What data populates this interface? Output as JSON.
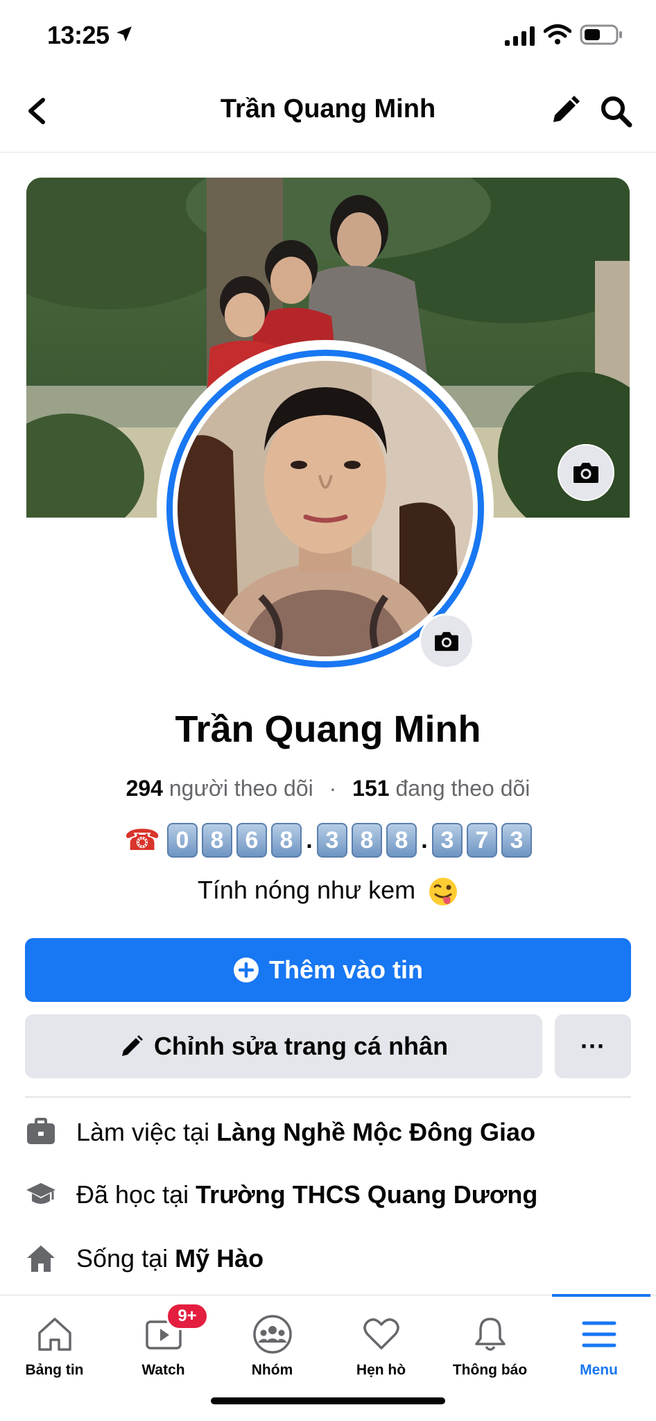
{
  "status_bar": {
    "time": "13:25"
  },
  "header": {
    "title": "Trần Quang Minh"
  },
  "profile": {
    "name": "Trần Quang Minh",
    "followers_count": "294",
    "followers_label": "người theo dõi",
    "following_count": "151",
    "following_label": "đang theo dõi",
    "separator": "·",
    "phone_digits": [
      "0",
      "8",
      "6",
      "8",
      ".",
      "3",
      "8",
      "8",
      ".",
      "3",
      "7",
      "3"
    ],
    "bio": "Tính nóng như kem"
  },
  "buttons": {
    "add_story": "Thêm vào tin",
    "edit_profile": "Chỉnh sửa trang cá nhân",
    "more": "···"
  },
  "details": [
    {
      "icon": "briefcase-icon",
      "prefix": "Làm việc tại",
      "value": "Làng Nghề Mộc Đông Giao"
    },
    {
      "icon": "graduation-cap-icon",
      "prefix": "Đã học tại",
      "value": "Trường THCS Quang Dương"
    },
    {
      "icon": "home-icon",
      "prefix": "Sống tại",
      "value": "Mỹ Hào"
    }
  ],
  "bottom_nav": {
    "items": [
      {
        "label": "Bảng tin",
        "icon": "home-icon"
      },
      {
        "label": "Watch",
        "icon": "video-icon",
        "badge": "9+"
      },
      {
        "label": "Nhóm",
        "icon": "groups-icon"
      },
      {
        "label": "Hẹn hò",
        "icon": "heart-icon"
      },
      {
        "label": "Thông báo",
        "icon": "bell-icon"
      },
      {
        "label": "Menu",
        "icon": "menu-icon",
        "active": true
      }
    ]
  },
  "colors": {
    "accent": "#1877f2",
    "badge": "#e41e3f",
    "secondary_button": "#e4e6eb",
    "muted_text": "#65676b"
  }
}
